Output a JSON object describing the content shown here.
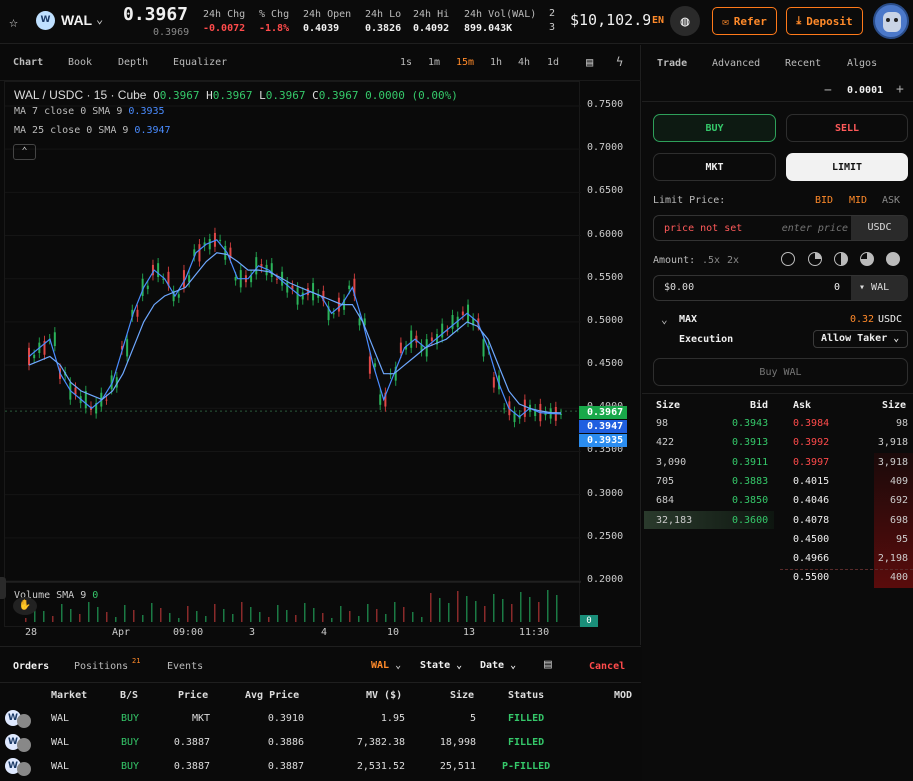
{
  "header": {
    "pair": "WAL",
    "coin_letter": "W",
    "price": "0.3967",
    "sub_price": "0.3969",
    "stats": [
      {
        "label": "24h Chg",
        "value": "-0.0072",
        "color": "#ff4b4b"
      },
      {
        "label": "% Chg",
        "value": "-1.8%",
        "color": "#ff4b4b"
      },
      {
        "label": "24h Open",
        "value": "0.4039",
        "color": "#f0f0f0"
      },
      {
        "label": "24h Lo",
        "value": "0.3826",
        "color": "#f0f0f0"
      },
      {
        "label": "24h Hi",
        "value": "0.4092",
        "color": "#f0f0f0"
      },
      {
        "label": "24h Vol(WAL)",
        "value": "899.043K",
        "color": "#f0f0f0"
      }
    ],
    "extra_top": "2",
    "extra_bottom": "3",
    "balance": "$10,102.9",
    "lang": "EN",
    "refer_label": "Refer",
    "deposit_label": "Deposit"
  },
  "chart_tabs": [
    "Chart",
    "Book",
    "Depth",
    "Equalizer"
  ],
  "timeframes": [
    "1s",
    "1m",
    "15m",
    "1h",
    "4h",
    "1d"
  ],
  "active_timeframe": "15m",
  "legend": {
    "symbol": "WAL / USDC · 15 · Cube",
    "o_label": "O",
    "o": "0.3967",
    "h_label": "H",
    "h": "0.3967",
    "l_label": "L",
    "l": "0.3967",
    "c_label": "C",
    "c": "0.3967",
    "chg": "0.0000 (0.00%)",
    "ma7_text": "MA 7 close 0 SMA 9",
    "ma7_val": "0.3935",
    "ma25_text": "MA 25 close 0 SMA 9",
    "ma25_val": "0.3947",
    "volume_text": "Volume SMA 9",
    "volume_val": "0"
  },
  "chart_data": {
    "type": "line",
    "title": "WAL / USDC · 15 · Cube",
    "y_ticks": [
      "0.7500",
      "0.7000",
      "0.6500",
      "0.6000",
      "0.5500",
      "0.5000",
      "0.4500",
      "0.4000",
      "0.3500",
      "0.3000",
      "0.2500",
      "0.2000"
    ],
    "ylim": [
      0.2,
      0.75
    ],
    "x_ticks": [
      "28",
      "Apr",
      "09:00",
      "3",
      "4",
      "10",
      "13",
      "11:30"
    ],
    "price_tags": [
      {
        "value": "0.3967",
        "color": "#19a84a"
      },
      {
        "value": "0.3947",
        "color": "#1f5fe0"
      },
      {
        "value": "0.3935",
        "color": "#2b8df0"
      }
    ],
    "volume_tag": "0",
    "series": [
      {
        "name": "MA 7",
        "color": "#4a8cff",
        "values": [
          0.46,
          0.47,
          0.48,
          0.44,
          0.42,
          0.41,
          0.4,
          0.41,
          0.43,
          0.47,
          0.51,
          0.54,
          0.56,
          0.55,
          0.53,
          0.55,
          0.58,
          0.59,
          0.595,
          0.58,
          0.55,
          0.55,
          0.565,
          0.56,
          0.55,
          0.54,
          0.53,
          0.535,
          0.53,
          0.51,
          0.52,
          0.54,
          0.5,
          0.45,
          0.41,
          0.44,
          0.47,
          0.48,
          0.47,
          0.48,
          0.49,
          0.5,
          0.51,
          0.5,
          0.47,
          0.43,
          0.4,
          0.39,
          0.4,
          0.395,
          0.394,
          0.3935
        ]
      },
      {
        "name": "MA 25",
        "color": "#6ea8ff",
        "values": [
          0.45,
          0.455,
          0.46,
          0.45,
          0.43,
          0.42,
          0.415,
          0.41,
          0.42,
          0.44,
          0.47,
          0.5,
          0.52,
          0.53,
          0.535,
          0.54,
          0.555,
          0.57,
          0.58,
          0.578,
          0.57,
          0.56,
          0.56,
          0.558,
          0.552,
          0.545,
          0.54,
          0.535,
          0.53,
          0.525,
          0.52,
          0.52,
          0.5,
          0.47,
          0.44,
          0.44,
          0.45,
          0.46,
          0.47,
          0.475,
          0.48,
          0.49,
          0.5,
          0.495,
          0.48,
          0.45,
          0.42,
          0.405,
          0.4,
          0.397,
          0.395,
          0.3947
        ]
      }
    ]
  },
  "trade_tabs": [
    "Trade",
    "Advanced",
    "Recent",
    "Algos"
  ],
  "tick_size": "0.0001",
  "buy_label": "BUY",
  "sell_label": "SELL",
  "mkt_label": "MKT",
  "limit_label": "LIMIT",
  "limit_price_label": "Limit Price:",
  "bid_label": "BID",
  "mid_label": "MID",
  "ask_label": "ASK",
  "price_not_set": "price not set",
  "price_placeholder": "enter price",
  "quote": "USDC",
  "amount_label": "Amount:",
  "lev_options": [
    ".5x",
    "2x"
  ],
  "amount_usd": "$0.00",
  "amount_qty": "0",
  "amount_unit": "WAL",
  "max_label": "MAX",
  "max_value": "0.32",
  "max_unit": "USDC",
  "execution_label": "Execution",
  "execution_value": "Allow Taker",
  "buy_wal_label": "Buy WAL",
  "book": {
    "headers": [
      "Size",
      "Bid",
      "Ask",
      "Size"
    ],
    "bids": [
      {
        "size": "98",
        "price": "0.3943"
      },
      {
        "size": "422",
        "price": "0.3913"
      },
      {
        "size": "3,090",
        "price": "0.3911"
      },
      {
        "size": "705",
        "price": "0.3883"
      },
      {
        "size": "684",
        "price": "0.3850"
      },
      {
        "size": "32,183",
        "price": "0.3600"
      }
    ],
    "asks": [
      {
        "price": "0.3984",
        "size": "98"
      },
      {
        "price": "0.3992",
        "size": "3,918"
      },
      {
        "price": "0.3997",
        "size": "3,918"
      },
      {
        "price": "0.4015",
        "size": "409"
      },
      {
        "price": "0.4046",
        "size": "692"
      },
      {
        "price": "0.4078",
        "size": "698"
      },
      {
        "price": "0.4500",
        "size": "95"
      },
      {
        "price": "0.4966",
        "size": "2,198"
      },
      {
        "price": "0.5500",
        "size": "400"
      }
    ]
  },
  "orders": {
    "tabs": [
      "Orders",
      "Positions",
      "Events"
    ],
    "positions_badge": "21",
    "filter_pair": "WAL",
    "filter_state": "State",
    "filter_date": "Date",
    "cancel_label": "Cancel",
    "headers": [
      "Market",
      "B/S",
      "Price",
      "Avg Price",
      "MV ($)",
      "Size",
      "Status",
      "MOD"
    ],
    "rows": [
      {
        "market": "WAL",
        "side": "BUY",
        "price": "MKT",
        "avg": "0.3910",
        "mv": "1.95",
        "size": "5",
        "status": "FILLED"
      },
      {
        "market": "WAL",
        "side": "BUY",
        "price": "0.3887",
        "avg": "0.3886",
        "mv": "7,382.38",
        "size": "18,998",
        "status": "FILLED"
      },
      {
        "market": "WAL",
        "side": "BUY",
        "price": "0.3887",
        "avg": "0.3887",
        "mv": "2,531.52",
        "size": "25,511",
        "status": "P-FILLED"
      }
    ]
  }
}
